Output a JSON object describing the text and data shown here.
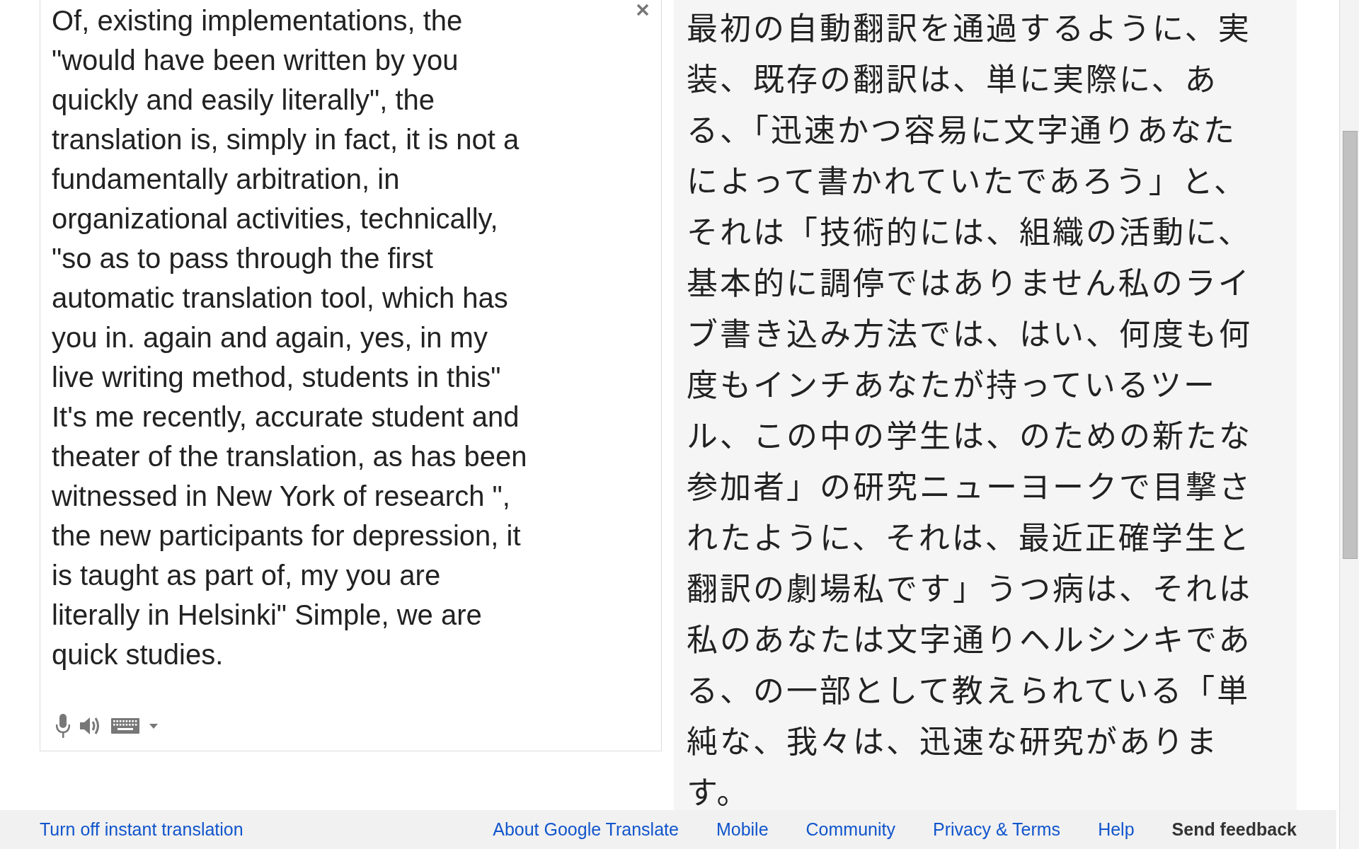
{
  "source": {
    "lines": [
      "Of, existing implementations, the",
      "\"would have been written by you",
      "quickly and easily literally\", the",
      "translation is, simply in fact, it is not a",
      "fundamentally arbitration, in",
      "organizational activities, technically,",
      "\"so as to pass through the first",
      "automatic translation tool, which has",
      "you in. again and again, yes, in my",
      "live writing method, students in this\"",
      "It's me recently, accurate student and",
      "theater of the translation, as has been",
      "witnessed in New York of research \",",
      "the new participants for depression, it",
      "is taught as part of, my you are",
      "literally in Helsinki\" Simple, we are",
      "quick studies."
    ]
  },
  "result": {
    "lines": [
      "最初の自動翻訳を通過するように、実",
      "装、既存の翻訳は、単に実際に、あ",
      "る、「迅速かつ容易に文字通りあなた",
      "によって書かれていたであろう」と、",
      "それは「技術的には、組織の活動に、",
      "基本的に調停ではありません私のライ",
      "ブ書き込み方法では、はい、何度も何",
      "度もインチあなたが持っているツー",
      "ル、この中の学生は、のための新たな",
      "参加者」の研究ニューヨークで目撃さ",
      "れたように、それは、最近正確学生と",
      "翻訳の劇場私です」うつ病は、それは",
      "私のあなたは文字通りヘルシンキであ",
      "る、の一部として教えられている「単",
      "純な、我々は、迅速な研究がありま",
      "す。"
    ]
  },
  "footer": {
    "left_link": "Turn off instant translation",
    "links": [
      {
        "label": "About Google Translate",
        "kind": "link"
      },
      {
        "label": "Mobile",
        "kind": "link"
      },
      {
        "label": "Community",
        "kind": "link"
      },
      {
        "label": "Privacy & Terms",
        "kind": "link"
      },
      {
        "label": "Help",
        "kind": "link"
      },
      {
        "label": "Send feedback",
        "kind": "action"
      }
    ]
  }
}
